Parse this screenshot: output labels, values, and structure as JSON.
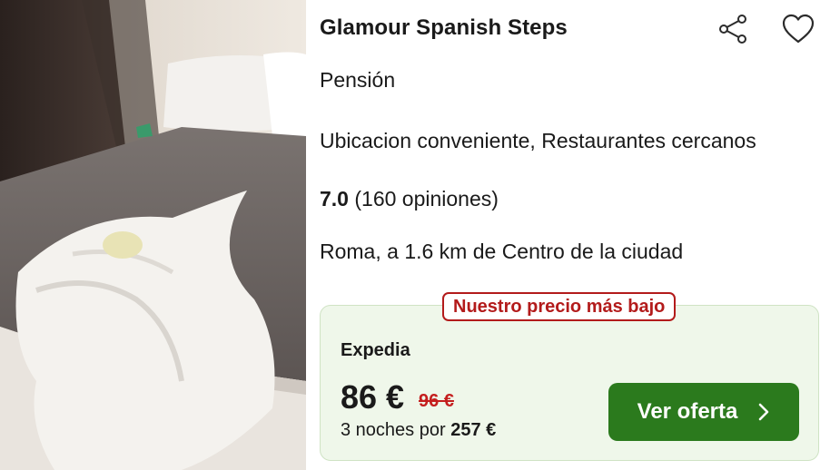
{
  "hotel": {
    "name": "Glamour Spanish Steps",
    "type": "Pensión",
    "features": "Ubicacion conveniente, Restaurantes cercanos",
    "rating_score": "7.0",
    "rating_reviews": "(160 opiniones)",
    "location": "Roma, a 1.6 km de Centro de la ciudad"
  },
  "icons": {
    "share": "share-icon",
    "favorite": "heart-icon",
    "chevron": "chevron-right-icon"
  },
  "deal": {
    "badge": "Nuestro precio más bajo",
    "provider": "Expedia",
    "price": "86 €",
    "old_price": "96 €",
    "nights_prefix": "3 noches por",
    "total": "257 €",
    "cta_label": "Ver oferta"
  },
  "colors": {
    "cta_green": "#2b7a1d",
    "deal_background": "#eff7ea",
    "badge_red": "#b31b1b",
    "strike_red": "#c41e1e"
  }
}
